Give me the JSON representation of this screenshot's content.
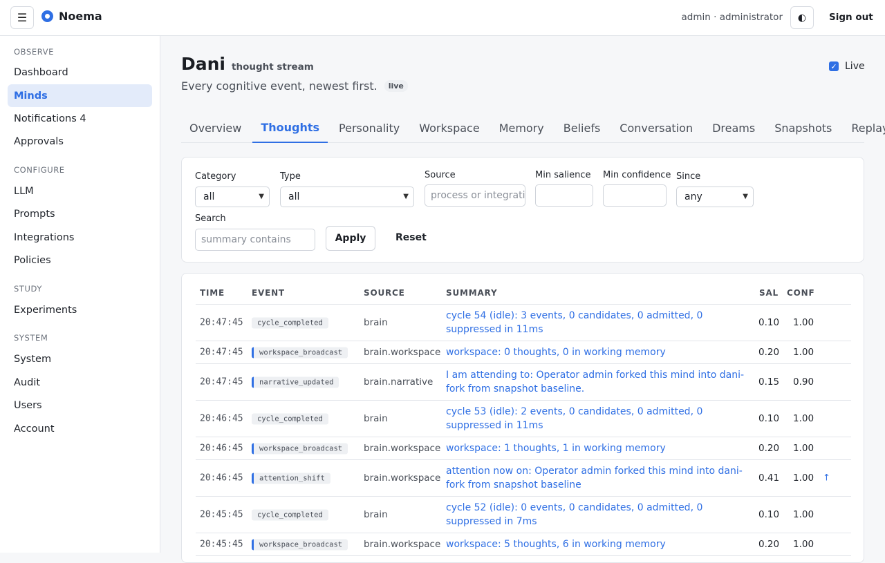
{
  "header": {
    "menu_icon": "☰",
    "brand": "Noema",
    "user": "admin · administrator",
    "theme_icon": "◐",
    "sign_out": "Sign out"
  },
  "sidebar": {
    "sections": [
      {
        "title": "OBSERVE",
        "items": [
          {
            "label": "Dashboard"
          },
          {
            "label": "Minds",
            "active": true
          },
          {
            "label": "Notifications 4"
          },
          {
            "label": "Approvals"
          }
        ]
      },
      {
        "title": "CONFIGURE",
        "items": [
          {
            "label": "LLM"
          },
          {
            "label": "Prompts"
          },
          {
            "label": "Integrations"
          },
          {
            "label": "Policies"
          }
        ]
      },
      {
        "title": "STUDY",
        "items": [
          {
            "label": "Experiments"
          }
        ]
      },
      {
        "title": "SYSTEM",
        "items": [
          {
            "label": "System"
          },
          {
            "label": "Audit"
          },
          {
            "label": "Users"
          },
          {
            "label": "Account"
          }
        ]
      }
    ]
  },
  "page": {
    "title": "Dani",
    "title_sub": "thought stream",
    "subtitle": "Every cognitive event, newest first.",
    "live_badge": "live",
    "live_toggle": "Live",
    "live_checked": true
  },
  "tabs": [
    "Overview",
    "Thoughts",
    "Personality",
    "Workspace",
    "Memory",
    "Beliefs",
    "Conversation",
    "Dreams",
    "Snapshots",
    "Replay"
  ],
  "active_tab": "Thoughts",
  "filters": {
    "category_label": "Category",
    "category_value": "all",
    "type_label": "Type",
    "type_value": "all",
    "source_label": "Source",
    "source_placeholder": "process or integrati",
    "min_salience_label": "Min salience",
    "min_confidence_label": "Min confidence",
    "since_label": "Since",
    "since_value": "any",
    "search_label": "Search",
    "search_placeholder": "summary contains",
    "apply": "Apply",
    "reset": "Reset"
  },
  "table": {
    "headers": {
      "time": "TIME",
      "event": "EVENT",
      "source": "SOURCE",
      "summary": "SUMMARY",
      "sal": "SAL",
      "conf": "CONF"
    },
    "rows": [
      {
        "time": "20:47:45",
        "event": "cycle_completed",
        "source": "brain",
        "summary": "cycle 54 (idle): 3 events, 0 candidates, 0 admitted, 0 suppressed in 11ms",
        "sal": "0.10",
        "conf": "1.00",
        "arrow": "",
        "tall": true,
        "bar": false
      },
      {
        "time": "20:47:45",
        "event": "workspace_broadcast",
        "source": "brain.workspace",
        "summary": "workspace: 0 thoughts, 0 in working memory",
        "sal": "0.20",
        "conf": "1.00",
        "arrow": "",
        "tall": false,
        "bar": true
      },
      {
        "time": "20:47:45",
        "event": "narrative_updated",
        "source": "brain.narrative",
        "summary": "I am attending to: Operator admin forked this mind into dani-fork from snapshot baseline.",
        "sal": "0.15",
        "conf": "0.90",
        "arrow": "",
        "tall": true,
        "bar": true
      },
      {
        "time": "20:46:45",
        "event": "cycle_completed",
        "source": "brain",
        "summary": "cycle 53 (idle): 2 events, 0 candidates, 0 admitted, 0 suppressed in 11ms",
        "sal": "0.10",
        "conf": "1.00",
        "arrow": "",
        "tall": true,
        "bar": false
      },
      {
        "time": "20:46:45",
        "event": "workspace_broadcast",
        "source": "brain.workspace",
        "summary": "workspace: 1 thoughts, 1 in working memory",
        "sal": "0.20",
        "conf": "1.00",
        "arrow": "",
        "tall": false,
        "bar": true
      },
      {
        "time": "20:46:45",
        "event": "attention_shift",
        "source": "brain.workspace",
        "summary": "attention now on: Operator admin forked this mind into dani-fork from snapshot baseline",
        "sal": "0.41",
        "conf": "1.00",
        "arrow": "↑",
        "tall": true,
        "bar": true
      },
      {
        "time": "20:45:45",
        "event": "cycle_completed",
        "source": "brain",
        "summary": "cycle 52 (idle): 0 events, 0 candidates, 0 admitted, 0 suppressed in 7ms",
        "sal": "0.10",
        "conf": "1.00",
        "arrow": "",
        "tall": true,
        "bar": false
      },
      {
        "time": "20:45:45",
        "event": "workspace_broadcast",
        "source": "brain.workspace",
        "summary": "workspace: 5 thoughts, 6 in working memory",
        "sal": "0.20",
        "conf": "1.00",
        "arrow": "",
        "tall": false,
        "bar": true
      }
    ]
  }
}
